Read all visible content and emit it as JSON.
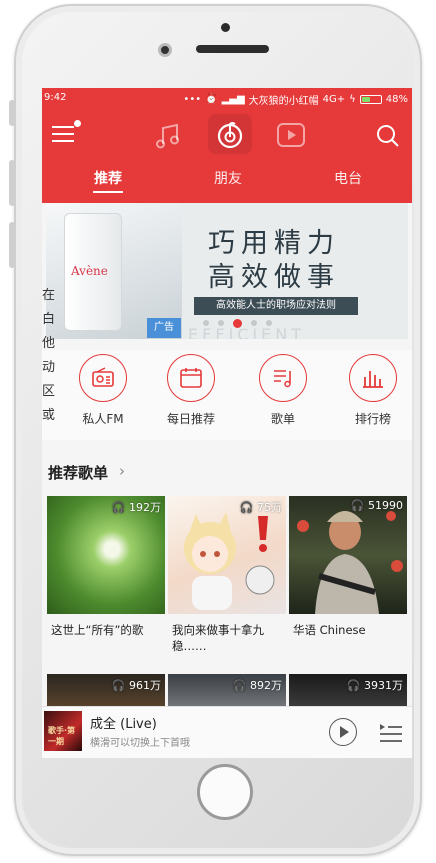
{
  "status": {
    "time": "9:42",
    "carrier": "大灰狼的小红帽",
    "network": "4G+",
    "battery": "48%",
    "battery_level": 0.48
  },
  "topbar": {
    "icons": [
      "menu-icon",
      "music-icon",
      "netease-logo-icon",
      "video-icon",
      "search-icon"
    ]
  },
  "tabs": [
    {
      "label": "推荐",
      "active": true
    },
    {
      "label": "朋友",
      "active": false
    },
    {
      "label": "电台",
      "active": false
    }
  ],
  "banner": {
    "brand": "Avène",
    "title_line1": "巧用精力",
    "title_line2": "高效做事",
    "subtitle": "高效能人士的职场应对法则",
    "ad_label": "广告",
    "watermark": "EFFICIENT",
    "pages": 5,
    "current_page": 3
  },
  "left_overlay": [
    "在",
    "白",
    "他",
    "动",
    "区",
    "或"
  ],
  "quick": [
    {
      "label": "私人FM",
      "icon": "radio-icon"
    },
    {
      "label": "每日推荐",
      "icon": "calendar-icon"
    },
    {
      "label": "歌单",
      "icon": "playlist-icon"
    },
    {
      "label": "排行榜",
      "icon": "chart-bars-icon"
    }
  ],
  "section": {
    "title": "推荐歌单",
    "arrow": "›"
  },
  "playlists": [
    {
      "count": "192万",
      "title": "这世上“所有”的歌"
    },
    {
      "count": "75万",
      "title": "我向来做事十拿九稳……"
    },
    {
      "count": "51990",
      "title": "华语 Chinese"
    }
  ],
  "playlists_row2": [
    {
      "count": "961万"
    },
    {
      "count": "892万"
    },
    {
      "count": "3931万"
    }
  ],
  "player": {
    "title": "成全 (Live)",
    "subtitle": "横滑可以切换上下首哦",
    "art_text": "歌手·第一期"
  },
  "colors": {
    "accent": "#e5393a",
    "text": "#222222"
  }
}
